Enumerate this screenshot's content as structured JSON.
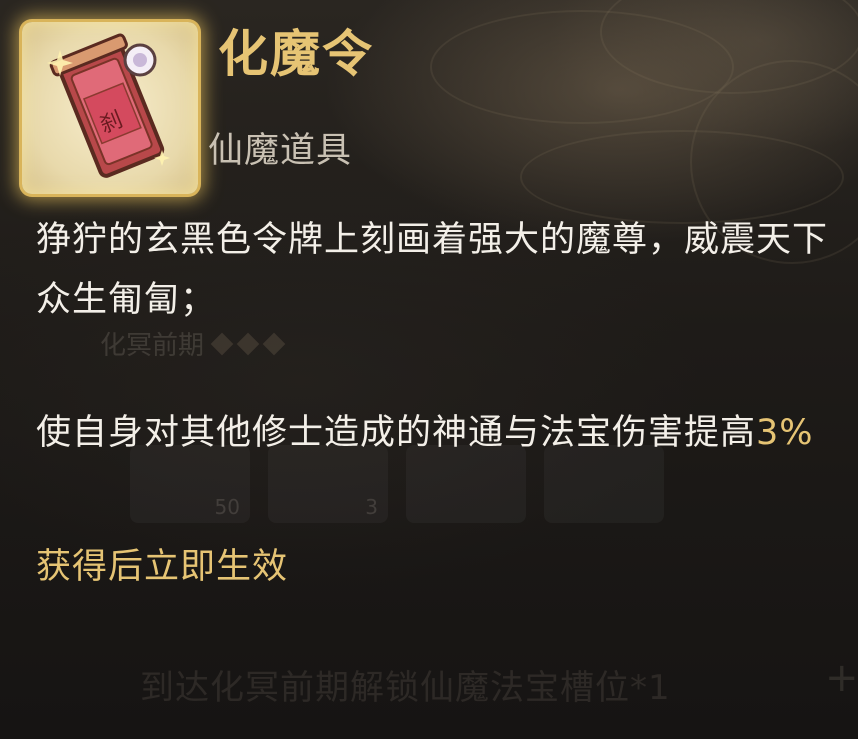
{
  "item": {
    "name": "化魔令",
    "category": "仙魔道具",
    "description": "狰狞的玄黑色令牌上刻画着强大的魔尊，威震天下众生匍匐；",
    "effect_prefix": "使自身对其他修士造成的神通与法宝伤害提高",
    "effect_value": "3%",
    "activation_note": "获得后立即生效",
    "icon": "demon-token-icon",
    "icon_glyph": "刹"
  },
  "background": {
    "realm_label": "化冥前期",
    "slot_counts": [
      "50",
      "3"
    ],
    "unlock_text": "到达化冥前期解锁仙魔法宝槽位*1",
    "plus_label": "+"
  },
  "colors": {
    "accent_gold": "#e6c474",
    "text_main": "#f3efe8",
    "text_muted": "#c9c1b3",
    "panel_bg": "#1c1917"
  }
}
